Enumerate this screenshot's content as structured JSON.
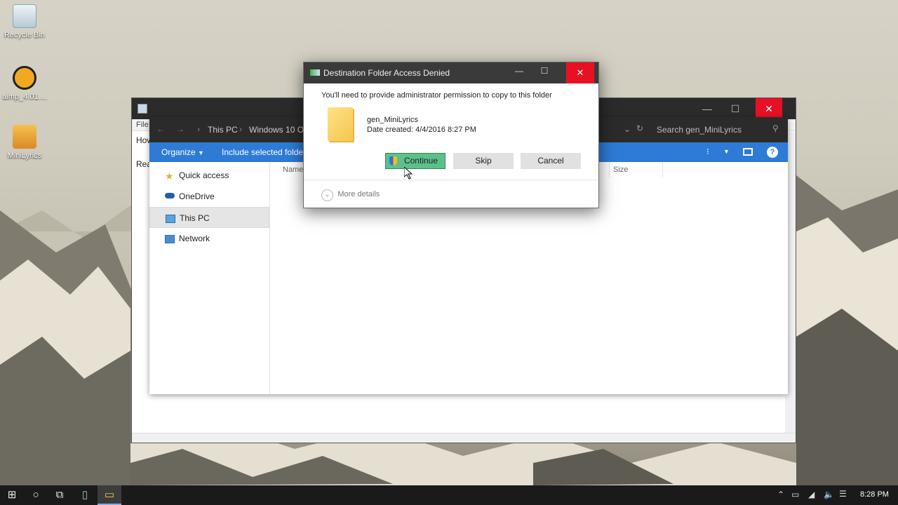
{
  "desktop": {
    "icons": [
      {
        "label": "Recycle Bin"
      },
      {
        "label": "aimp_4.01...."
      },
      {
        "label": "MiniLyrics"
      }
    ]
  },
  "explorer": {
    "ribbon_file": "File",
    "left_fragment_1": "How",
    "left_fragment_2": "Rea"
  },
  "inner_explorer": {
    "breadcrumb": [
      "This PC",
      "Windows 10 OS"
    ],
    "search_placeholder": "Search gen_MiniLyrics",
    "organize_label": "Organize",
    "include_label": "Include selected folder",
    "column_name": "Name",
    "column_size": "Size",
    "nav": [
      {
        "label": "Quick access",
        "icon": "star-icon"
      },
      {
        "label": "OneDrive",
        "icon": "cloud-icon"
      },
      {
        "label": "This PC",
        "icon": "computer-icon",
        "selected": true
      },
      {
        "label": "Network",
        "icon": "network-icon"
      }
    ]
  },
  "dialog": {
    "title": "Destination Folder Access Denied",
    "message": "You'll need to provide administrator permission to copy to this folder",
    "folder_name": "gen_MiniLyrics",
    "date_created": "Date created: 4/4/2016 8:27 PM",
    "continue_label": "Continue",
    "skip_label": "Skip",
    "cancel_label": "Cancel",
    "more_details": "More details"
  },
  "taskbar": {
    "time": "8:28 PM"
  },
  "colors": {
    "accent": "#2d7bd6",
    "close_red": "#e81123",
    "continue_green": "#5cc08a"
  }
}
